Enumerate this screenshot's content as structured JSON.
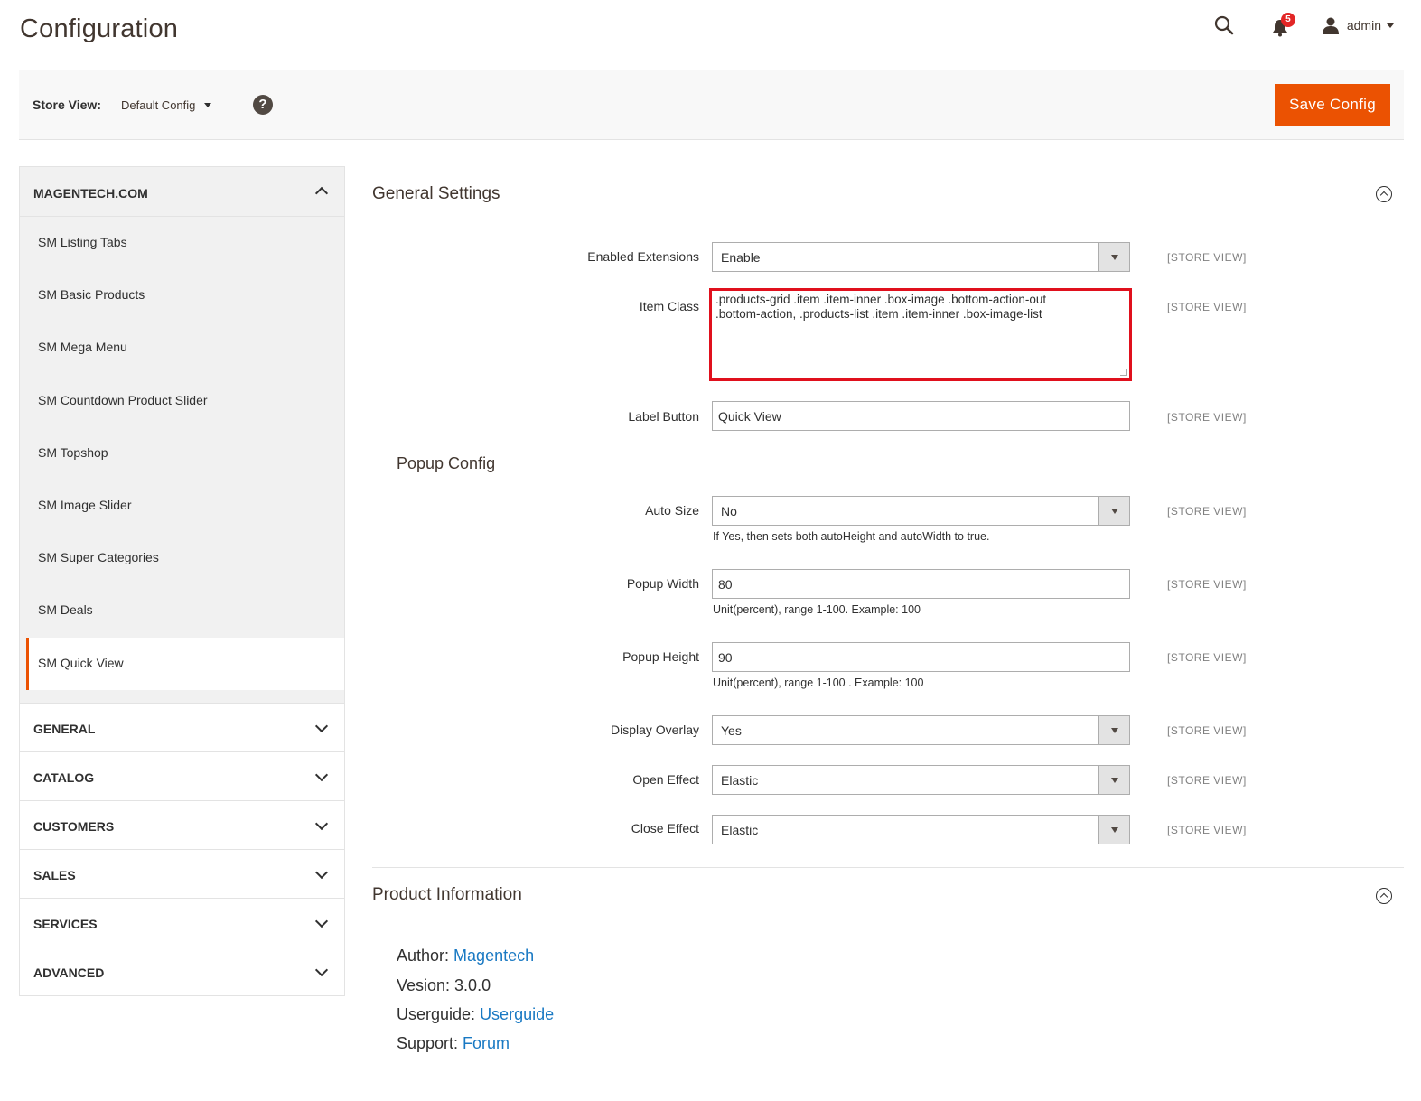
{
  "header": {
    "title": "Configuration",
    "notifications_count": "5",
    "user_name": "admin"
  },
  "store_bar": {
    "label": "Store View:",
    "value": "Default Config",
    "help": "?",
    "save_label": "Save Config"
  },
  "sidebar": {
    "section_title": "MAGENTECH.COM",
    "items": [
      {
        "label": "SM Listing Tabs"
      },
      {
        "label": "SM Basic Products"
      },
      {
        "label": "SM Mega Menu"
      },
      {
        "label": "SM Countdown Product Slider"
      },
      {
        "label": "SM Topshop"
      },
      {
        "label": "SM Image Slider"
      },
      {
        "label": "SM Super Categories"
      },
      {
        "label": "SM Deals"
      },
      {
        "label": "SM Quick View"
      }
    ],
    "groups": [
      {
        "label": "GENERAL"
      },
      {
        "label": "CATALOG"
      },
      {
        "label": "CUSTOMERS"
      },
      {
        "label": "SALES"
      },
      {
        "label": "SERVICES"
      },
      {
        "label": "ADVANCED"
      }
    ]
  },
  "general": {
    "title": "General Settings",
    "scope": "[STORE VIEW]",
    "enabled_label": "Enabled Extensions",
    "enabled_value": "Enable",
    "item_class_label": "Item Class",
    "item_class_value": ".products-grid .item .item-inner .box-image .bottom-action-out\n.bottom-action, .products-list .item .item-inner .box-image-list",
    "label_button_label": "Label Button",
    "label_button_value": "Quick View",
    "popup_title": "Popup Config",
    "auto_size_label": "Auto Size",
    "auto_size_value": "No",
    "auto_size_note": "If Yes, then sets both autoHeight and autoWidth to true.",
    "popup_width_label": "Popup Width",
    "popup_width_value": "80",
    "popup_width_note": "Unit(percent), range 1-100. Example: 100",
    "popup_height_label": "Popup Height",
    "popup_height_value": "90",
    "popup_height_note": "Unit(percent), range 1-100 . Example: 100",
    "overlay_label": "Display Overlay",
    "overlay_value": "Yes",
    "open_effect_label": "Open Effect",
    "open_effect_value": "Elastic",
    "close_effect_label": "Close Effect",
    "close_effect_value": "Elastic"
  },
  "product_info": {
    "title": "Product Information",
    "author_label": "Author: ",
    "author_link": "Magentech",
    "version_text": "Vesion: 3.0.0",
    "guide_label": "Userguide: ",
    "guide_link": "Userguide",
    "support_label": "Support: ",
    "support_link": "Forum"
  },
  "colors": {
    "accent": "#eb5202",
    "link": "#1979c3",
    "highlight_border": "#e0101d",
    "badge": "#e22626"
  }
}
